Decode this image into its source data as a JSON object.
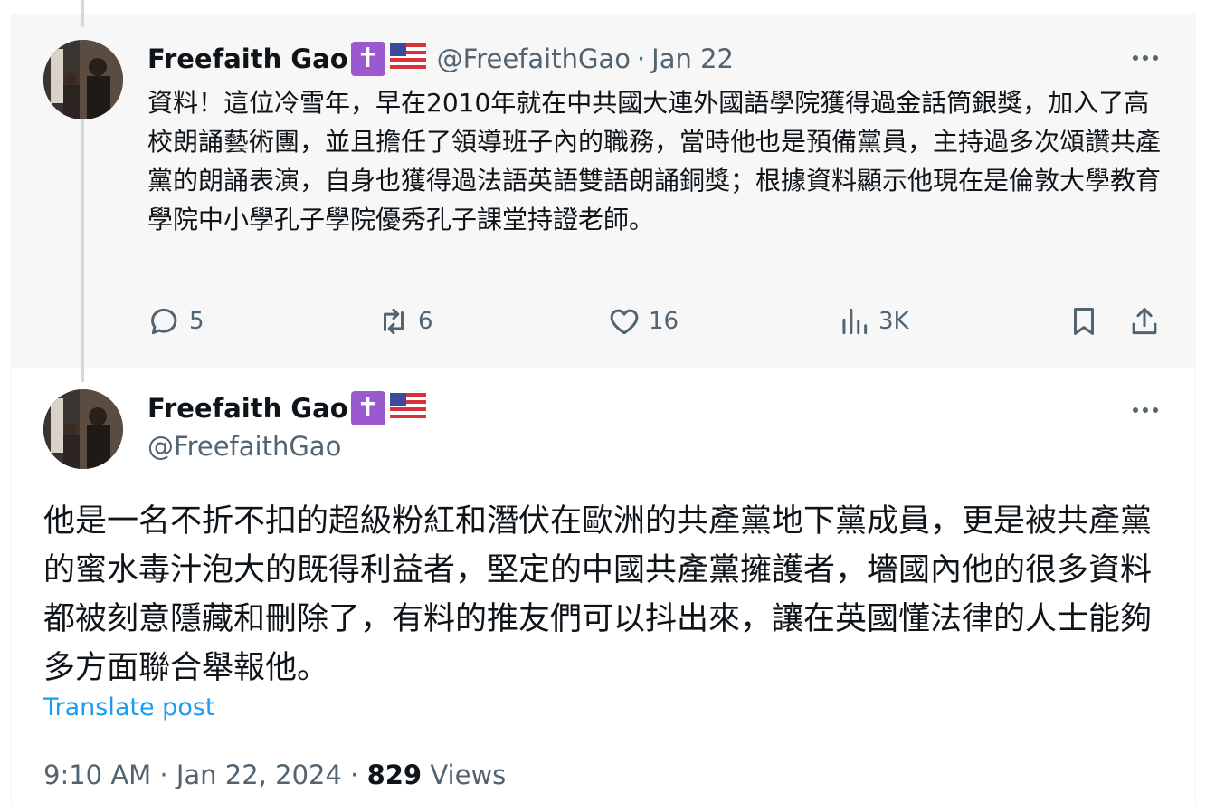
{
  "reply_tweet": {
    "display_name": "Freefaith Gao",
    "badge": "✝",
    "flag_icon": "us-flag-icon",
    "handle": "@FreefaithGao",
    "separator": "·",
    "time": "Jan 22",
    "text": "資料！這位冷雪年，早在2010年就在中共國大連外國語學院獲得過金話筒銀獎，加入了高校朗誦藝術團，並且擔任了領導班子內的職務，當時他也是預備黨員，主持過多次頌讚共產黨的朗誦表演，自身也獲得過法語英語雙語朗誦銅獎；根據資料顯示他現在是倫敦大學教育學院中小學孔子學院優秀孔子課堂持證老師。",
    "replies": "5",
    "reposts": "6",
    "likes": "16",
    "views": "3K"
  },
  "main_tweet": {
    "display_name": "Freefaith Gao",
    "badge": "✝",
    "flag_icon": "us-flag-icon",
    "handle": "@FreefaithGao",
    "text": "他是一名不折不扣的超級粉紅和潛伏在歐洲的共產黨地下黨成員，更是被共產黨的蜜水毒汁泡大的既得利益者，堅定的中國共產黨擁護者，墻國內他的很多資料都被刻意隱藏和刪除了，有料的推友們可以抖出來，讓在英國懂法律的人士能夠多方面聯合舉報他。",
    "translate_label": "Translate post",
    "timestamp": "9:10 AM · Jan 22, 2024 · ",
    "view_count": "829",
    "views_label": " Views"
  },
  "colors": {
    "text": "#0f1419",
    "muted": "#536471",
    "link": "#1d9bf0",
    "reply_bg": "#f7f7f7",
    "badge": "#9b59d0"
  }
}
